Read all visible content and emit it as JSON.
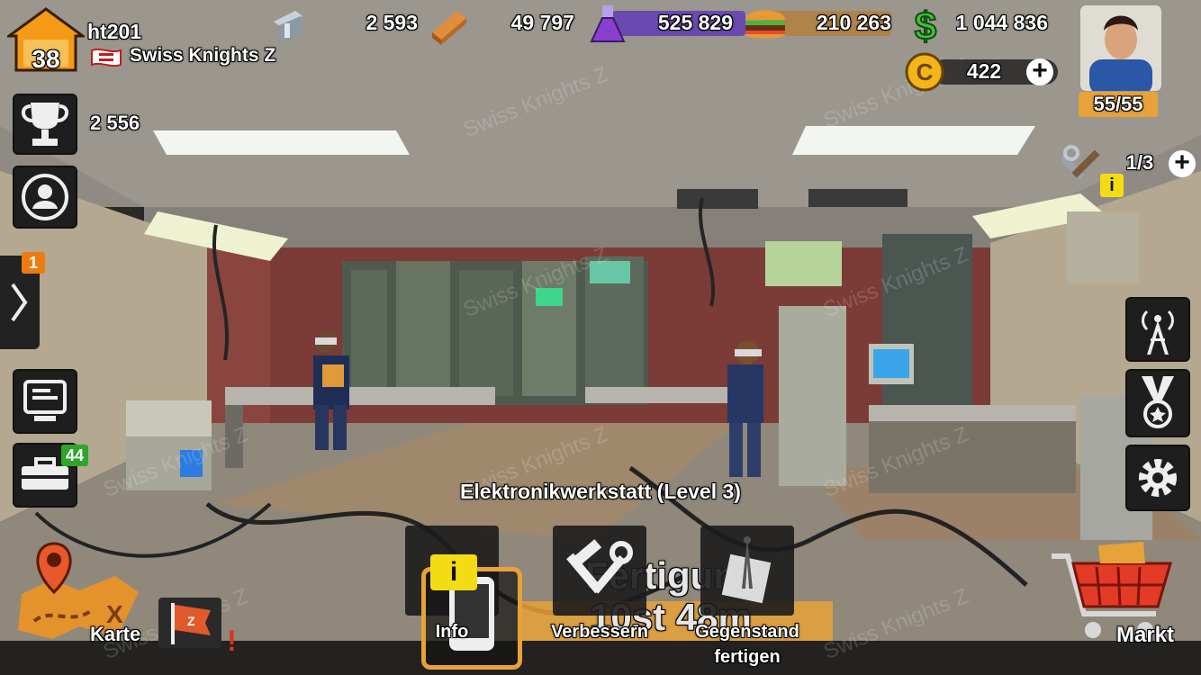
{
  "player": {
    "level": "38",
    "name": "ht201",
    "clan": "Swiss Knights Z",
    "trophies": "2 556",
    "energy": "55/55"
  },
  "resources": [
    {
      "name": "steel-icon",
      "value": "2 593"
    },
    {
      "name": "wood-icon",
      "value": "49 797"
    },
    {
      "name": "flask-icon",
      "value": "525 829"
    },
    {
      "name": "burger-icon",
      "value": "210 263"
    },
    {
      "name": "dollar-icon",
      "value": "1 044 836"
    }
  ],
  "coins": {
    "icon": "coin-icon",
    "value": "422"
  },
  "builders": {
    "icon": "tools-icon",
    "value": "1/3"
  },
  "side_badges": {
    "expand_count": "1",
    "vehicle_count": "44"
  },
  "building": {
    "title": "Elektronikwerkstatt (Level 3)"
  },
  "overlay": {
    "production_text": "Fertigung",
    "timer_text": "10st 48m"
  },
  "actions": [
    {
      "label": "Info"
    },
    {
      "label": "Verbessern"
    },
    {
      "label": "Gegenstand fertigen"
    }
  ],
  "nav": {
    "map_label": "Karte",
    "market_label": "Markt",
    "alert": "!"
  },
  "watermark": "Swiss Knights Z",
  "colors": {
    "resource_bar": "#6a4ab0",
    "energy": "#e8a23a",
    "badge_orange": "#f07a12",
    "badge_green": "#2fa52c",
    "info_yellow": "#f4dc14"
  }
}
